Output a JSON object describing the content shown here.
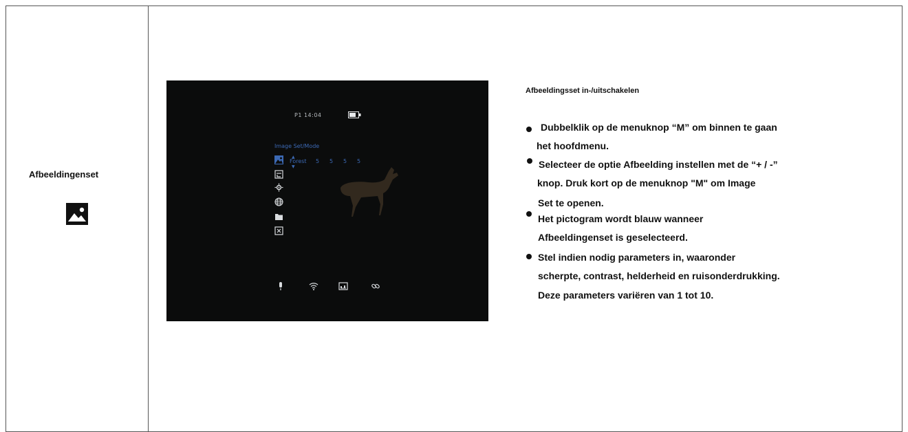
{
  "left": {
    "title": "Afbeeldingenset",
    "icon": "image-icon"
  },
  "screen": {
    "status": "P1   14:04",
    "mode_label": "Image Set/Mode",
    "row": {
      "name": "Forest",
      "values": [
        "5",
        "5",
        "5",
        "5"
      ]
    },
    "side_icons": [
      "image-icon",
      "profile-icon",
      "crosshair-icon",
      "globe-icon",
      "folder-icon",
      "close-box-icon"
    ],
    "bottom_icons": [
      "microphone-icon",
      "wifi-icon",
      "picture-in-picture-icon",
      "link-icon"
    ],
    "accent": "#3c69b4"
  },
  "right": {
    "title": "Afbeeldingsset in-/uitschakelen",
    "bullets": [
      {
        "lines": [
          "Dubbelklik op de menuknop “M” om binnen te gaan",
          "het hoofdmenu."
        ]
      },
      {
        "lines": [
          "Selecteer de optie Afbeelding instellen met de “+ / -”",
          "knop. Druk kort op de menuknop \"M\" om Image",
          "Set te openen."
        ]
      },
      {
        "lines": [
          "Het pictogram wordt blauw wanneer",
          "Afbeeldingenset is geselecteerd."
        ]
      },
      {
        "lines": [
          "Stel indien nodig parameters in, waaronder",
          "scherpte, contrast, helderheid en ruisonderdrukking.",
          "Deze parameters variëren van 1 tot 10."
        ]
      }
    ]
  }
}
